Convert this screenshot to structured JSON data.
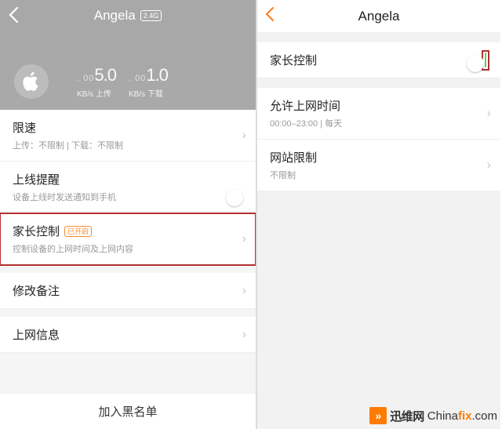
{
  "left": {
    "header": {
      "title": "Angela",
      "badge": "2.4G",
      "device_icon": "apple-icon",
      "stats": {
        "upload": {
          "prefix": ". 00",
          "value": "5.0",
          "unit": "KB/s",
          "label": "上传"
        },
        "download": {
          "prefix": ". 00",
          "value": "1.0",
          "unit": "KB/s",
          "label": "下载"
        }
      }
    },
    "rows": {
      "speed": {
        "title": "限速",
        "sub": "上传：不限制 | 下载：不限制"
      },
      "online": {
        "title": "上线提醒",
        "sub": "设备上线时发送通知到手机"
      },
      "parental": {
        "title": "家长控制",
        "pill": "已开启",
        "sub": "控制设备的上网时间及上网内容"
      },
      "remark": {
        "title": "修改备注"
      },
      "netinfo": {
        "title": "上网信息"
      }
    },
    "footer": "加入黑名单"
  },
  "right": {
    "header": {
      "title": "Angela"
    },
    "rows": {
      "pc": {
        "title": "家长控制"
      },
      "time": {
        "title": "允许上网时间",
        "sub": "00:00–23:00 | 每天"
      },
      "site": {
        "title": "网站限制",
        "sub": "不限制"
      }
    }
  },
  "watermark": {
    "cn": "迅维网",
    "en_pre": "China",
    "en_hl": "fix",
    "en_post": ".com"
  }
}
